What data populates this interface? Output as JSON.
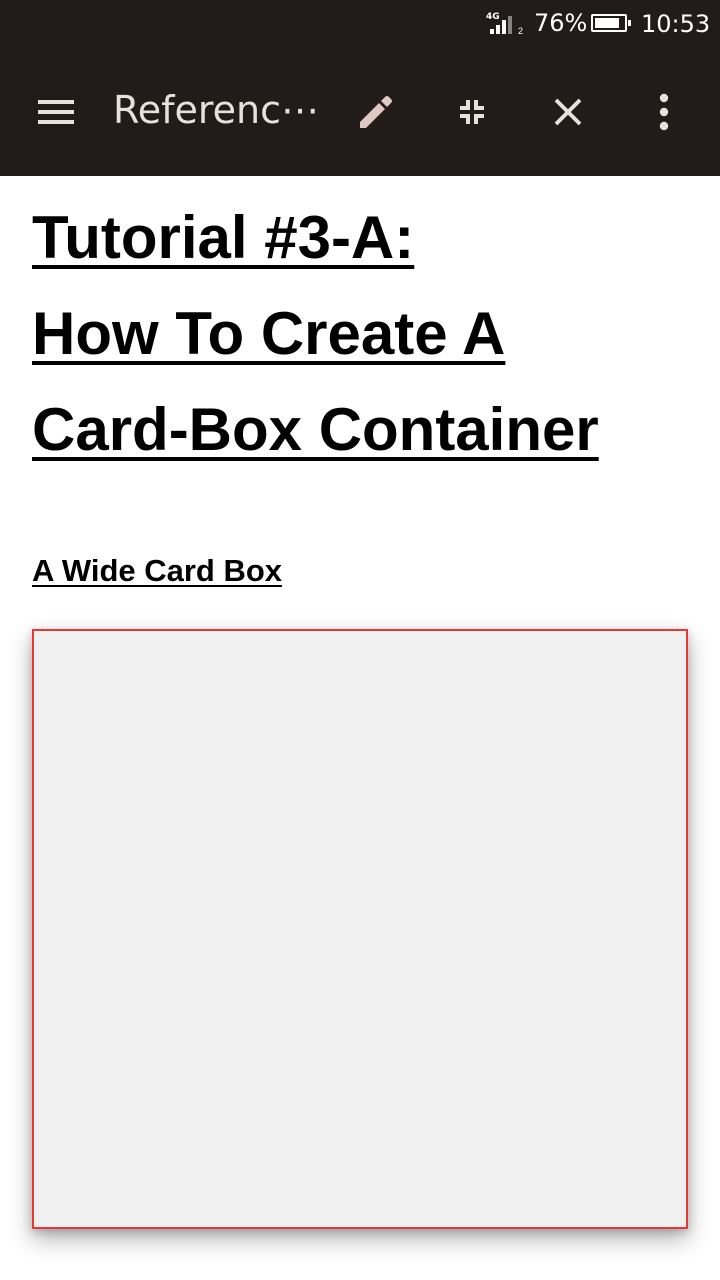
{
  "status_bar": {
    "network_label": "4G",
    "sim_slot": "2",
    "battery_percent_text": "76%",
    "battery_level": 0.76,
    "time": "10:53"
  },
  "app_bar": {
    "title": "Referenc⋯",
    "icons": [
      "menu-icon",
      "pencil-icon",
      "collapse-icon",
      "close-icon",
      "more-vert-icon"
    ],
    "colors": {
      "background": "#211c1a",
      "icon": "#e8e0dc"
    }
  },
  "content": {
    "title_lines": [
      "Tutorial #3-A:",
      "How To Create A",
      "Card-Box Container"
    ],
    "section_heading": "A Wide Card Box",
    "card": {
      "background": "#f0f0f0",
      "border_color": "#e53935"
    }
  }
}
